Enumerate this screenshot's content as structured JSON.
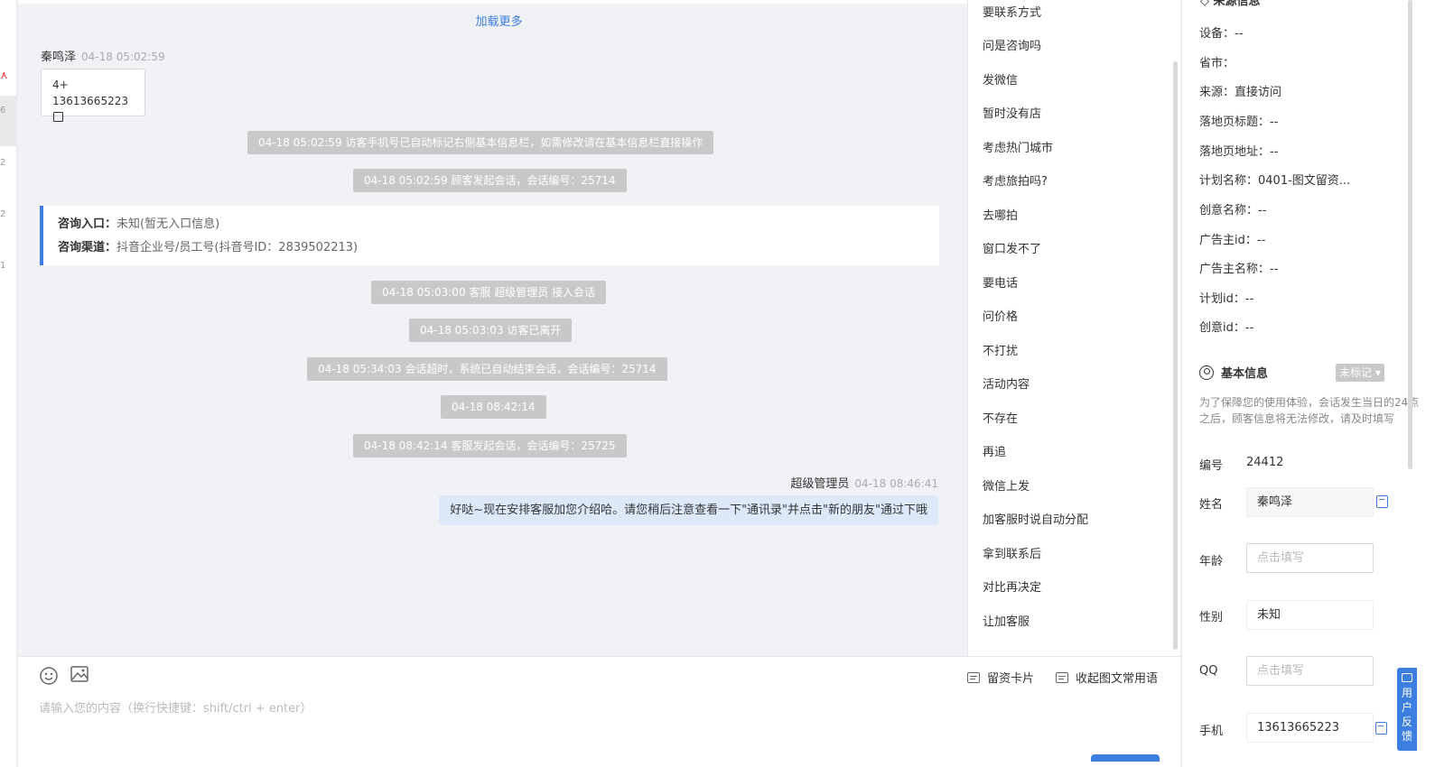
{
  "left_strip": {
    "numbers": [
      "6",
      "2",
      "2",
      "1"
    ]
  },
  "chat": {
    "load_more": "加载更多",
    "visitor_name": "秦鸣泽",
    "visitor_time": "04-18 05:02:59",
    "card_line1": "4+",
    "card_line2": "13613665223",
    "system_messages": [
      "04-18 05:02:59 访客手机号已自动标记右侧基本信息栏，如需修改请在基本信息栏直接操作",
      "04-18 05:02:59 顾客发起会话，会话编号：25714",
      "04-18 05:03:00 客服 超级管理员 接入会话",
      "04-18 05:03:03 访客已离开",
      "04-18 05:34:03 会话超时，系统已自动结束会话，会话编号：25714",
      "04-18 08:42:14",
      "04-18 08:42:14 客服发起会话，会话编号：25725"
    ],
    "info_entry_label": "咨询入口：",
    "info_entry_value": "未知(暂无入口信息)",
    "info_channel_label": "咨询渠道：",
    "info_channel_value": "抖音企业号/员工号(抖音号ID：2839502213)",
    "agent_name": "超级管理员",
    "agent_time": "04-18 08:46:41",
    "agent_message": "好哒~现在安排客服加您介绍哈。请您稍后注意查看一下\"通讯录\"并点击\"新的朋友\"通过下哦"
  },
  "composer": {
    "placeholder": "请输入您的内容（换行快捷键：shift/ctrl + enter）",
    "lead_card_label": "留资卡片",
    "collapse_label": "收起图文常用语",
    "icons": [
      "emoji-icon",
      "image-icon"
    ]
  },
  "quick_replies": [
    "要联系方式",
    "问是咨询吗",
    "发微信",
    "暂时没有店",
    "考虑热门城市",
    "考虑旅拍吗?",
    "去哪拍",
    "窗口发不了",
    "要电话",
    "问价格",
    "不打扰",
    "活动内容",
    "不存在",
    "再追",
    "微信上发",
    "加客服时说自动分配",
    "拿到联系后",
    "对比再决定",
    "让加客服"
  ],
  "source_info": {
    "title": "来源信息",
    "fields": [
      {
        "label": "设备：",
        "value": "--"
      },
      {
        "label": "省市：",
        "value": ""
      },
      {
        "label": "来源：",
        "value": "直接访问"
      },
      {
        "label": "落地页标题：",
        "value": "--"
      },
      {
        "label": "落地页地址：",
        "value": "--"
      },
      {
        "label": "计划名称：",
        "value": "0401-图文留资..."
      },
      {
        "label": "创意名称：",
        "value": "--"
      },
      {
        "label": "广告主id：",
        "value": "--"
      },
      {
        "label": "广告主名称：",
        "value": "--"
      },
      {
        "label": "计划id：",
        "value": "--"
      },
      {
        "label": "创意id：",
        "value": "--"
      }
    ]
  },
  "basic_info": {
    "title": "基本信息",
    "badge": "未标记",
    "notice": "为了保障您的使用体验，会话发生当日的24点之后，顾客信息将无法修改，请及时填写",
    "id_label": "编号",
    "id_value": "24412",
    "name_label": "姓名",
    "name_value": "秦鸣泽",
    "age_label": "年龄",
    "age_placeholder": "点击填写",
    "gender_label": "性别",
    "gender_value": "未知",
    "qq_label": "QQ",
    "qq_placeholder": "点击填写",
    "phone_label": "手机",
    "phone_value": "13613665223"
  },
  "feedback": {
    "label": "用户反馈"
  },
  "colors": {
    "accent": "#3d7fe0",
    "system_bubble": "#c8c8c8",
    "agent_bubble": "#dde9fb"
  }
}
